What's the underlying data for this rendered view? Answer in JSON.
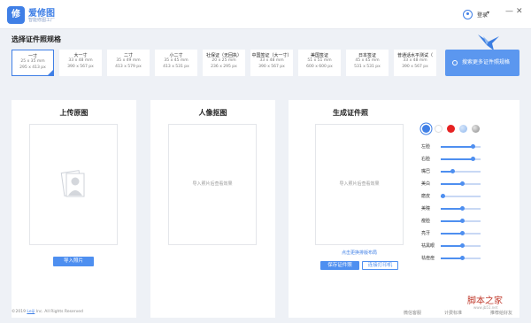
{
  "app": {
    "logo_text": "爱修图",
    "logo_glyph": "修",
    "tagline": "智能修图工厂"
  },
  "header": {
    "login_label": "登录",
    "caret": "▾",
    "minimize": "—",
    "close": "✕"
  },
  "selector": {
    "title": "选择证件照规格",
    "sizes": [
      {
        "name": "一寸",
        "mm": "25 x 35 mm",
        "px": "295 x 413 px",
        "active": true
      },
      {
        "name": "大一寸",
        "mm": "33 x 48 mm",
        "px": "390 x 567 px"
      },
      {
        "name": "二寸",
        "mm": "35 x 49 mm",
        "px": "413 x 579 px"
      },
      {
        "name": "小二寸",
        "mm": "35 x 45 mm",
        "px": "413 x 531 px"
      },
      {
        "name": "社保证（无回执）",
        "mm": "20 x 25 mm",
        "px": "236 x 295 px"
      },
      {
        "name": "中国签证（大一寸）",
        "mm": "33 x 48 mm",
        "px": "390 x 567 px"
      },
      {
        "name": "美国签证",
        "mm": "51 x 51 mm",
        "px": "600 x 600 px"
      },
      {
        "name": "日本签证",
        "mm": "45 x 45 mm",
        "px": "531 x 531 px"
      },
      {
        "name": "普通话水平测试（",
        "mm": "33 x 48 mm",
        "px": "390 x 567 px"
      }
    ],
    "search_button": "搜索更多证件照规格"
  },
  "upload_panel": {
    "title": "上传原图",
    "import_button": "导入照片"
  },
  "cutout_panel": {
    "title": "人像抠图",
    "placeholder": "导入照片后查看效果"
  },
  "result_panel": {
    "title": "生成证件照",
    "placeholder": "导入照片后查看效果",
    "link": "点击更换排版布局",
    "save_button": "保存证件照",
    "print_button": "连接打印机",
    "colors": [
      "#3f7fe6",
      "#ffffff",
      "#e62222",
      "#8fb8ee",
      "#9a9a9a"
    ],
    "adjustments": [
      {
        "label": "左脸",
        "value": 0.8
      },
      {
        "label": "右脸",
        "value": 0.8
      },
      {
        "label": "嘴巴",
        "value": 0.3
      },
      {
        "label": "美白",
        "value": 0.55
      },
      {
        "label": "磨皮",
        "value": 0.05
      },
      {
        "label": "美瞳",
        "value": 0.55
      },
      {
        "label": "瘦脸",
        "value": 0.55
      },
      {
        "label": "亮牙",
        "value": 0.55
      },
      {
        "label": "祛黑眼",
        "value": 0.55
      },
      {
        "label": "祛痘痘",
        "value": 0.55
      }
    ]
  },
  "footer": {
    "copyright_prefix": "©2019",
    "brand": "Leiji",
    "copyright_suffix": "Inc. All Rights Reserved",
    "links": [
      "微信客服",
      "计费标准",
      "推荐给好友"
    ]
  },
  "watermark": {
    "text": "脚本之家",
    "url": "www.jb51.net"
  }
}
